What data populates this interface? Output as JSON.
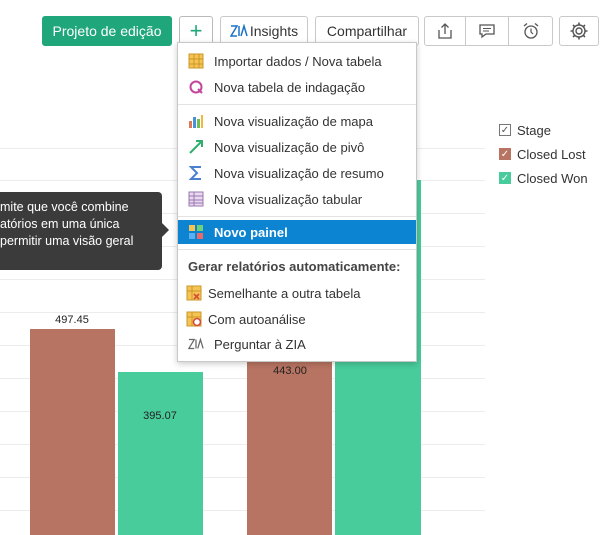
{
  "toolbar": {
    "edit_label": "Projeto de edição",
    "add_symbol": "+",
    "insights_label": "Insights",
    "share_label": "Compartilhar"
  },
  "menu": {
    "items": [
      {
        "label": "Importar dados / Nova tabela",
        "icon": "table-grid-icon"
      },
      {
        "label": "Nova tabela de indagação",
        "icon": "query-icon"
      },
      {
        "label": "Nova visualização de mapa",
        "icon": "bar-chart-icon"
      },
      {
        "label": "Nova visualização de pivô",
        "icon": "pivot-arrow-icon"
      },
      {
        "label": "Nova visualização de resumo",
        "icon": "sigma-icon"
      },
      {
        "label": "Nova visualização tabular",
        "icon": "tabular-icon"
      },
      {
        "label": "Novo painel",
        "icon": "dashboard-icon"
      }
    ],
    "auto_heading": "Gerar relatórios automaticamente:",
    "auto_items": [
      {
        "label": "Semelhante a outra tabela",
        "icon": "similar-table-icon"
      },
      {
        "label": "Com autoanálise",
        "icon": "auto-analysis-icon"
      },
      {
        "label": "Perguntar à ZIA",
        "icon": "zia-icon"
      }
    ]
  },
  "tooltip": {
    "lines": [
      "mite que você combine",
      "atórios em uma única",
      "permitir uma visão geral"
    ]
  },
  "legend": {
    "title": "Stage",
    "items": [
      {
        "label": "Closed Lost",
        "color": "#b87462"
      },
      {
        "label": "Closed Won",
        "color": "#48cc9c"
      }
    ]
  },
  "chart_data": {
    "type": "bar",
    "series": [
      {
        "name": "Closed Lost",
        "color": "#b87462",
        "values": [
          497.45,
          443.0
        ]
      },
      {
        "name": "Closed Won",
        "color": "#48cc9c",
        "values": [
          395.07,
          null
        ]
      }
    ],
    "data_labels": [
      "497.45",
      "395.07",
      "443.00"
    ]
  }
}
